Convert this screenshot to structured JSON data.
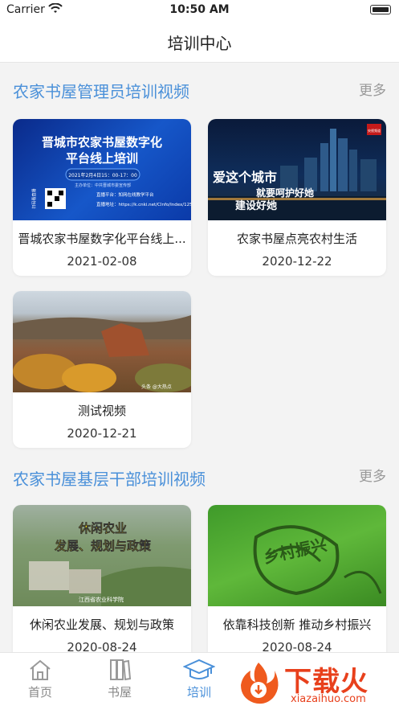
{
  "status_bar": {
    "carrier": "Carrier",
    "time": "10:50 AM"
  },
  "navbar": {
    "title": "培训中心"
  },
  "sections": [
    {
      "title": "农家书屋管理员培训视频",
      "more": "更多",
      "cards": [
        {
          "title": "晋城农家书屋数字化平台线上...",
          "date": "2021-02-08",
          "thumb_text": {
            "line1": "晋城市农家书屋数字化",
            "line2": "平台线上培训",
            "line3": "2021年2月4日15：00-17：00",
            "line4": "主办单位：中共晋城市委宣传部",
            "line5": "直播平台：知网在线教学平台",
            "line6": "直播地址：https://k.cnki.net/CInfo/Index/12550",
            "qr_label": "扫码看直播"
          }
        },
        {
          "title": "农家书屋点亮农村生活",
          "date": "2020-12-22",
          "thumb_text": {
            "line1": "爱这个城市",
            "line2": "就要呵护好她",
            "line3": "建设好她",
            "badge": "央视频道"
          }
        },
        {
          "title": "测试视频",
          "date": "2020-12-21",
          "thumb_text": {
            "corner": "头条 @大热点"
          }
        }
      ]
    },
    {
      "title": "农家书屋基层干部培训视频",
      "more": "更多",
      "cards": [
        {
          "title": "休闲农业发展、规划与政策",
          "date": "2020-08-24",
          "thumb_text": {
            "line1": "休闲农业",
            "line2": "发展、规划与政策",
            "line3": "江西省农业科学院"
          }
        },
        {
          "title": "依靠科技创新 推动乡村振兴",
          "date": "2020-08-24",
          "thumb_text": {
            "line1": "乡村振兴"
          }
        }
      ]
    }
  ],
  "tabbar": {
    "items": [
      {
        "label": "首页",
        "icon": "home-icon"
      },
      {
        "label": "书屋",
        "icon": "bookshelf-icon"
      },
      {
        "label": "培训",
        "icon": "graduation-cap-icon"
      }
    ],
    "active_index": 2
  },
  "watermark": {
    "brand": "下载火",
    "sub": "xiazaihuo.com"
  },
  "colors": {
    "accent": "#4a90d9",
    "more": "#999999",
    "watermark": "#e8401c"
  }
}
